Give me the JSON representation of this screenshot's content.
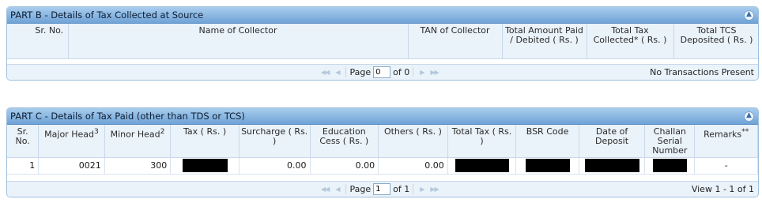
{
  "part_b": {
    "title": "PART B - Details of Tax Collected at Source",
    "collapse_icon": "chevron-up-icon",
    "headers": {
      "sr": "Sr. No.",
      "name": "Name of Collector",
      "tan": "TAN of Collector",
      "paid": "Total Amount Paid / Debited ( Rs. )",
      "collected": "Total Tax Collected* ( Rs. )",
      "deposited": "Total TCS Deposited ( Rs. )"
    },
    "pager": {
      "page_label": "Page",
      "page_value": "0",
      "of_label": "of 0"
    },
    "status": "No Transactions Present"
  },
  "part_c": {
    "title": "PART C - Details of Tax Paid (other than TDS or TCS)",
    "collapse_icon": "chevron-up-icon",
    "headers": {
      "sr": "Sr. No.",
      "major": "Major Head",
      "major_sup": "3",
      "minor": "Minor Head",
      "minor_sup": "2",
      "tax": "Tax ( Rs. )",
      "surcharge": "Surcharge ( Rs. )",
      "cess": "Education Cess ( Rs. )",
      "others": "Others ( Rs. )",
      "total": "Total Tax ( Rs. )",
      "bsr": "BSR Code",
      "date": "Date of Deposit",
      "challan": "Challan Serial Number",
      "remarks": "Remarks",
      "remarks_sup": "**"
    },
    "rows": [
      {
        "sr": "1",
        "major": "0021",
        "minor": "300",
        "surcharge": "0.00",
        "cess": "0.00",
        "others": "0.00",
        "remarks": "-"
      }
    ],
    "pager": {
      "page_label": "Page",
      "page_value": "1",
      "of_label": "of 1"
    },
    "status": "View 1 - 1 of 1"
  }
}
